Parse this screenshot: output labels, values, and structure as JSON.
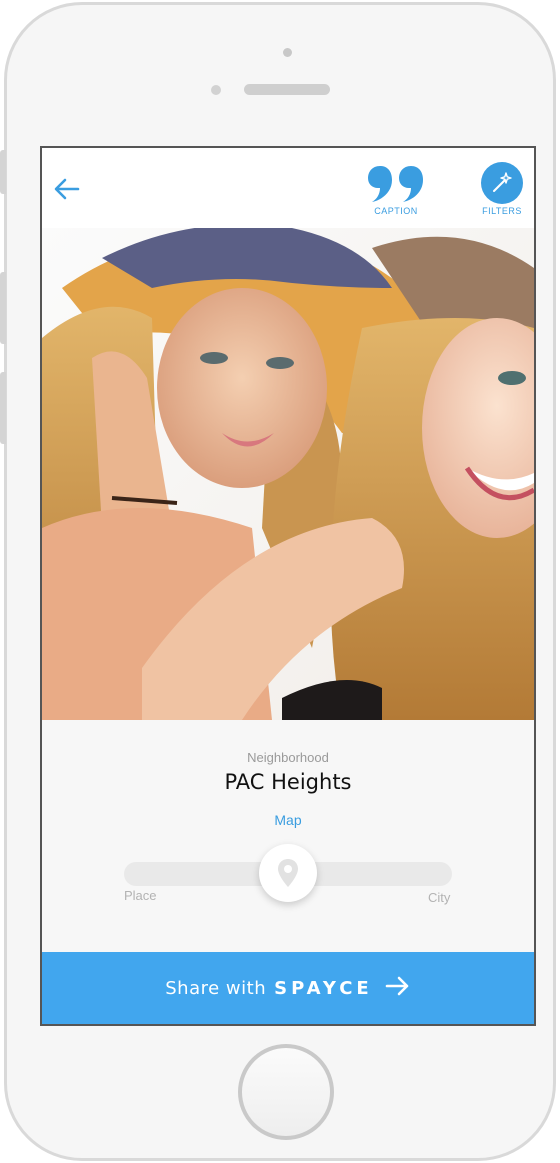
{
  "header": {
    "caption_label": "CAPTION",
    "filters_label": "FILTERS",
    "back_icon": "arrow-left-icon",
    "caption_icon": "quote-icon",
    "filters_icon": "magic-wand-icon"
  },
  "location": {
    "label": "Neighborhood",
    "name": "PAC Heights",
    "map_link": "Map"
  },
  "slider": {
    "left_label": "Place",
    "right_label": "City",
    "value": 0.5,
    "thumb_icon": "location-pin-icon"
  },
  "share": {
    "prefix": "Share with",
    "brand": "SPAYCE",
    "arrow_icon": "arrow-right-icon"
  },
  "colors": {
    "accent": "#3a9de0",
    "share_bar": "#41a6ee"
  }
}
